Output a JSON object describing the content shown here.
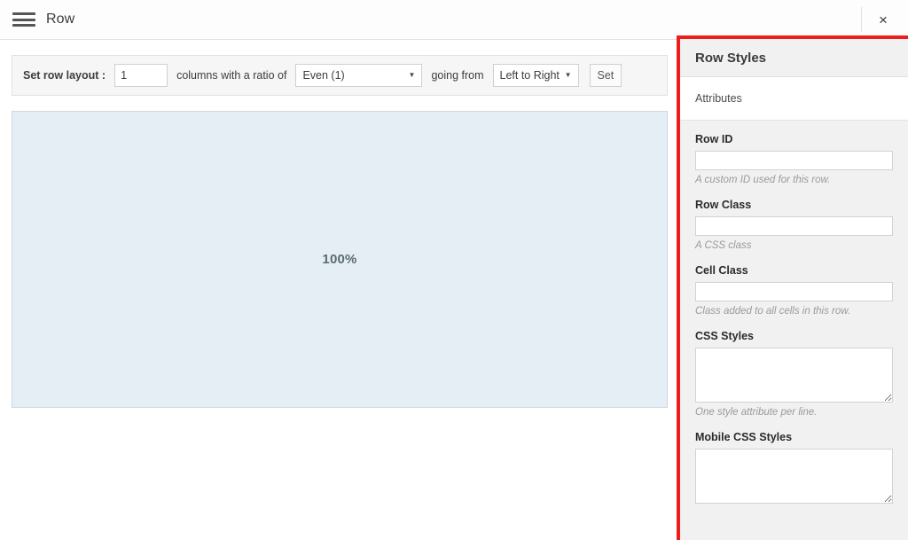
{
  "topbar": {
    "menu_icon": "hamburger-icon",
    "title": "Row",
    "close_icon": "×"
  },
  "toolbar": {
    "set_row_layout_label": "Set row layout :",
    "columns_value": "1",
    "columns_text": "columns with a ratio of",
    "ratio_value": "Even (1)",
    "going_from_text": "going from",
    "direction_value": "Left to Right",
    "set_button": "Set",
    "caret": "▼"
  },
  "canvas": {
    "row_width_label": "100%"
  },
  "sidebar": {
    "title": "Row Styles",
    "tabs": [
      {
        "label": "Attributes",
        "active": true
      }
    ],
    "fields": [
      {
        "label": "Row ID",
        "value": "",
        "help": "A custom ID used for this row.",
        "type": "text",
        "name": "row-id"
      },
      {
        "label": "Row Class",
        "value": "",
        "help": "A CSS class",
        "type": "text",
        "name": "row-class"
      },
      {
        "label": "Cell Class",
        "value": "",
        "help": "Class added to all cells in this row.",
        "type": "text",
        "name": "cell-class"
      },
      {
        "label": "CSS Styles",
        "value": "",
        "help": "One style attribute per line.",
        "type": "textarea",
        "name": "css-styles"
      },
      {
        "label": "Mobile CSS Styles",
        "value": "",
        "help": "",
        "type": "textarea",
        "name": "mobile-css-styles"
      }
    ]
  },
  "colors": {
    "highlight_border": "#ee1c1c",
    "row_preview_bg": "#e4eef4",
    "panel_bg": "#f1f1f1"
  }
}
